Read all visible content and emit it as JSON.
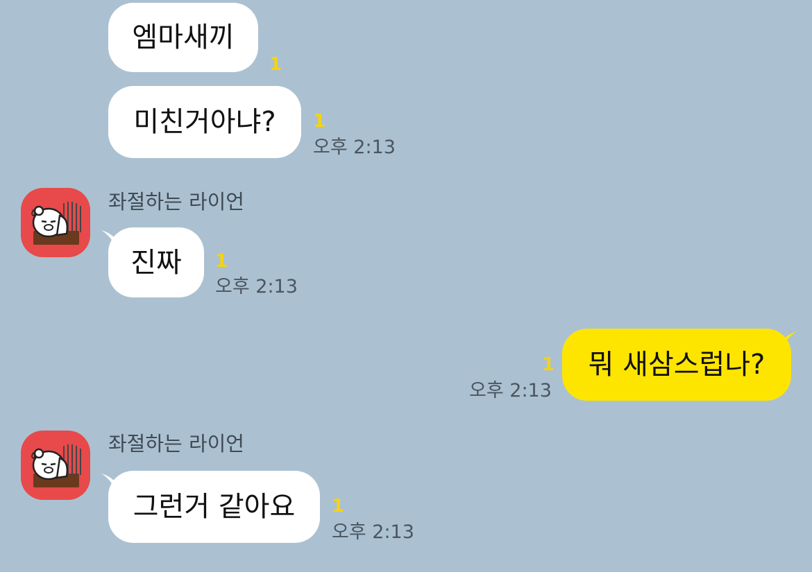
{
  "chat": {
    "messages": [
      {
        "text": "엠마새끼",
        "unread": "1"
      },
      {
        "text": "미친거아냐?",
        "unread": "1",
        "time": "오후 2:13"
      },
      {
        "sender": "좌절하는 라이언",
        "text": "진짜",
        "unread": "1",
        "time": "오후 2:13"
      },
      {
        "text": "뭐 새삼스럽나?",
        "unread": "1",
        "time": "오후 2:13"
      },
      {
        "sender": "좌절하는 라이언",
        "text": "그런거 같아요",
        "unread": "1",
        "time": "오후 2:13"
      }
    ]
  },
  "colors": {
    "background": "#abc1d1",
    "incoming_bubble": "#ffffff",
    "outgoing_bubble": "#fee500",
    "unread_count": "#f5d215",
    "avatar_background": "#e8494a"
  },
  "icons": {
    "avatar": "frustrated-lion-avatar-icon"
  }
}
